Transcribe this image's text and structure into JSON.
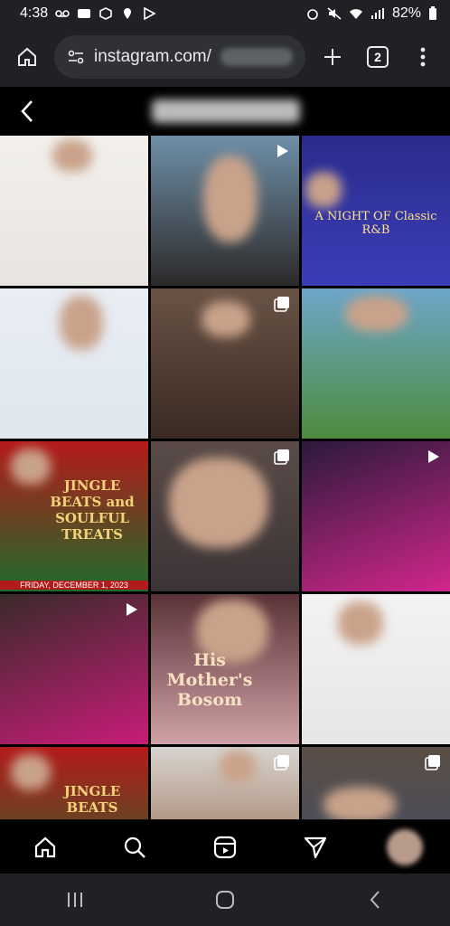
{
  "status_bar": {
    "time": "4:38",
    "battery": "82%"
  },
  "browser": {
    "url": "instagram.com/",
    "tab_count": "2"
  },
  "posts": [
    {
      "bg": "linear-gradient(180deg,#f2f0ee,#e8e4e0)",
      "text": ""
    },
    {
      "bg": "linear-gradient(180deg,#6e8fa8,#2c2a2a)",
      "text": ""
    },
    {
      "bg": "linear-gradient(180deg,#2a2c8c,#3b3db8)",
      "text": "A NIGHT OF Classic R&B"
    },
    {
      "bg": "linear-gradient(180deg,#e9eef4,#dfe6ee)",
      "text": ""
    },
    {
      "bg": "linear-gradient(180deg,#6a5346,#3a2a22)",
      "text": ""
    },
    {
      "bg": "linear-gradient(180deg,#6ea6c9,#4c8b3c)",
      "text": ""
    },
    {
      "bg": "linear-gradient(180deg,#b51a1a,#1e6b2b)",
      "text": "JINGLE BEATS and SOULFUL TREATS",
      "footer": "FRIDAY, DECEMBER 1, 2023"
    },
    {
      "bg": "linear-gradient(180deg,#5a4b48,#3b3436)",
      "text": ""
    },
    {
      "bg": "linear-gradient(160deg,#2a1a3a,#d2268c)",
      "text": ""
    },
    {
      "bg": "linear-gradient(160deg,#3a2a2a,#c81c78)",
      "text": ""
    },
    {
      "bg": "linear-gradient(180deg,#5a3236,#d0a2a6)",
      "text": "His Mother's Bosom"
    },
    {
      "bg": "linear-gradient(180deg,#f3f3f3,#e6e6e6)",
      "text": ""
    },
    {
      "bg": "linear-gradient(180deg,#b51a1a,#1e6b2b)",
      "text": "JINGLE BEATS"
    },
    {
      "bg": "linear-gradient(180deg,#d8d4cf,#8b5a3c)",
      "text": ""
    },
    {
      "bg": "linear-gradient(180deg,#5a4e45,#3e4c6a)",
      "text": ""
    }
  ],
  "badges": [
    null,
    "reel-icon",
    null,
    null,
    "carousel-icon",
    null,
    null,
    "carousel-icon",
    "reel-icon",
    "reel-icon",
    null,
    null,
    null,
    "carousel-icon",
    "carousel-icon"
  ],
  "nav": {
    "items": [
      "home-icon",
      "search-icon",
      "reels-icon",
      "send-icon",
      "profile-avatar"
    ]
  }
}
